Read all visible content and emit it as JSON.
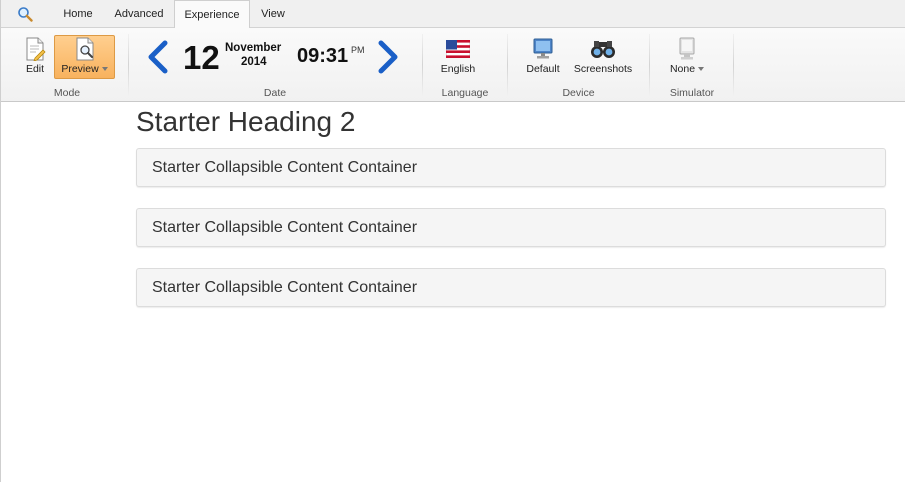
{
  "tabs": [
    {
      "label": "Home"
    },
    {
      "label": "Advanced"
    },
    {
      "label": "Experience",
      "active": true
    },
    {
      "label": "View"
    }
  ],
  "mode": {
    "edit_label": "Edit",
    "preview_label": "Preview",
    "group_label": "Mode"
  },
  "date": {
    "day": "12",
    "month": "November",
    "year": "2014",
    "time": "09:31",
    "ampm": "PM",
    "group_label": "Date"
  },
  "language": {
    "value": "English",
    "group_label": "Language"
  },
  "device": {
    "default_label": "Default",
    "screenshots_label": "Screenshots",
    "group_label": "Device"
  },
  "simulator": {
    "value": "None",
    "group_label": "Simulator"
  },
  "content": {
    "heading": "Starter Heading 2",
    "containers": [
      {
        "label": "Starter Collapsible Content Container"
      },
      {
        "label": "Starter Collapsible Content Container"
      },
      {
        "label": "Starter Collapsible Content Container"
      }
    ]
  },
  "colors": {
    "accent_arrow": "#1a5fc7",
    "preview_active": "#f8b25e"
  }
}
